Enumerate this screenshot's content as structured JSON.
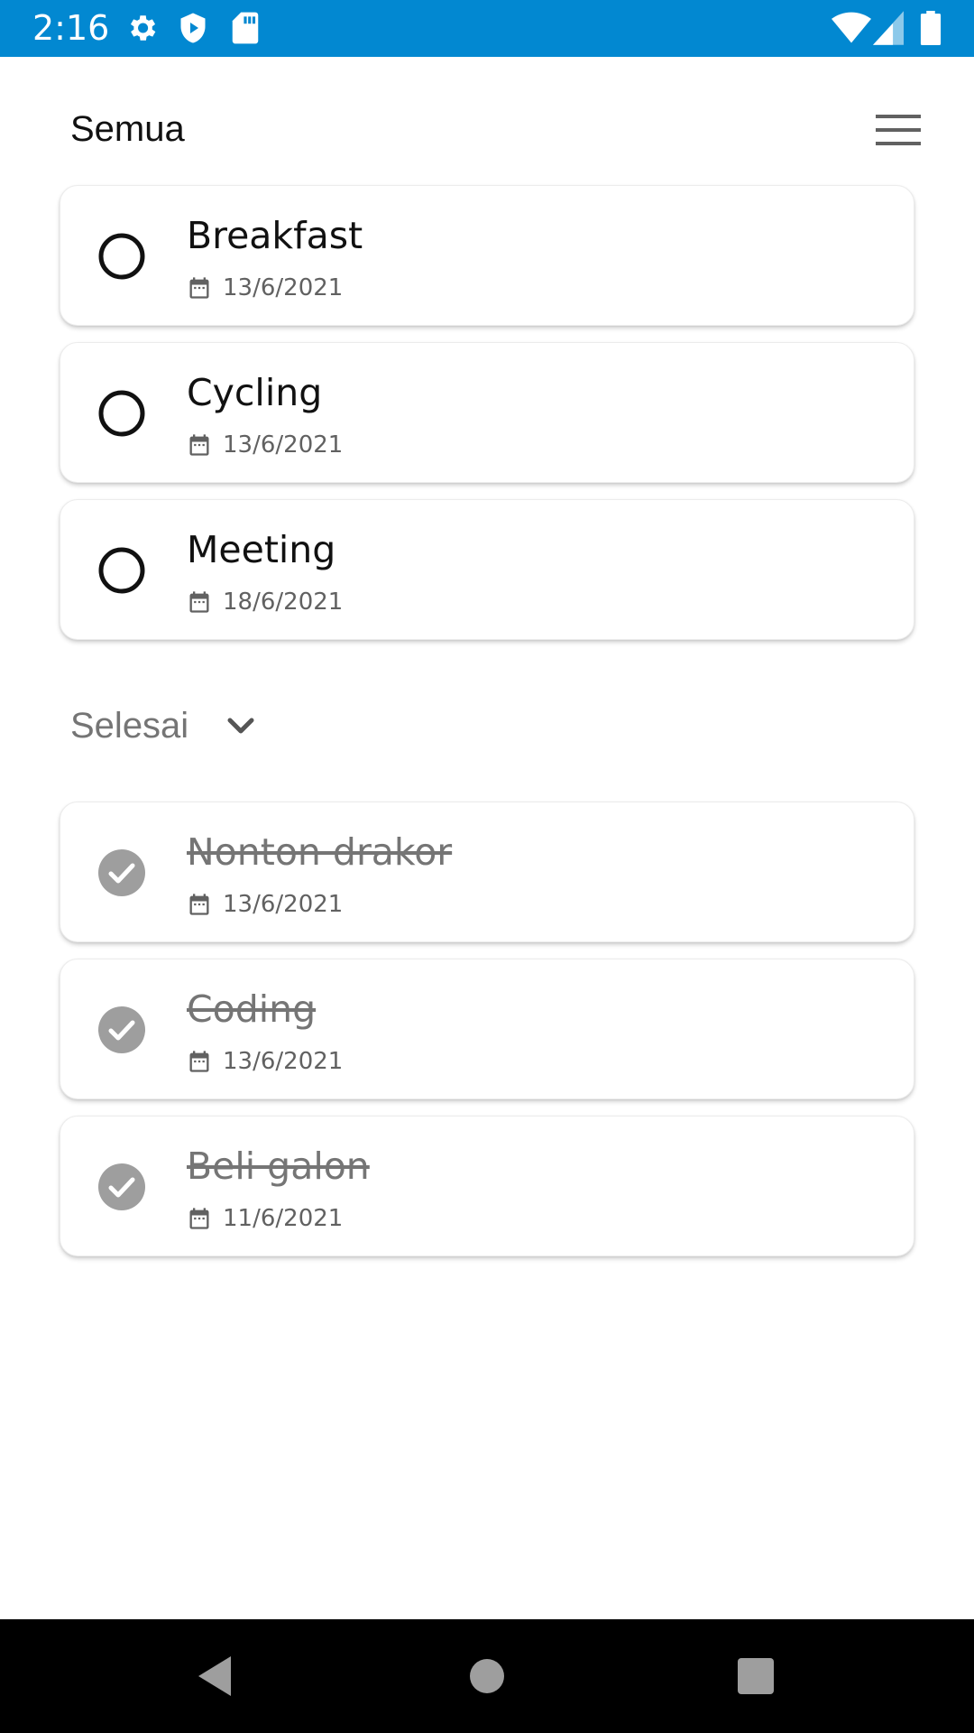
{
  "status_bar": {
    "time": "2:16",
    "icons": [
      "settings-icon",
      "shield-icon",
      "sd-card-icon",
      "wifi-icon",
      "signal-icon",
      "battery-icon"
    ],
    "background": "#0288d1"
  },
  "header": {
    "title": "Semua",
    "menu_icon": "menu-icon"
  },
  "tasks": [
    {
      "title": "Breakfast",
      "date": "13/6/2021",
      "done": false
    },
    {
      "title": "Cycling",
      "date": "13/6/2021",
      "done": false
    },
    {
      "title": "Meeting",
      "date": "18/6/2021",
      "done": false
    }
  ],
  "completed_section": {
    "label": "Selesai",
    "icon": "chevron-down-icon"
  },
  "completed_tasks": [
    {
      "title": "Nonton drakor",
      "date": "13/6/2021",
      "done": true
    },
    {
      "title": "Coding",
      "date": "13/6/2021",
      "done": true
    },
    {
      "title": "Beli galon",
      "date": "11/6/2021",
      "done": true
    }
  ],
  "nav_bar": {
    "icons": [
      "back-icon",
      "home-icon",
      "recents-icon"
    ]
  },
  "colors": {
    "accent": "#0288d1",
    "done_check": "#9e9e9e",
    "text_primary": "#111111",
    "text_muted": "#757575"
  }
}
